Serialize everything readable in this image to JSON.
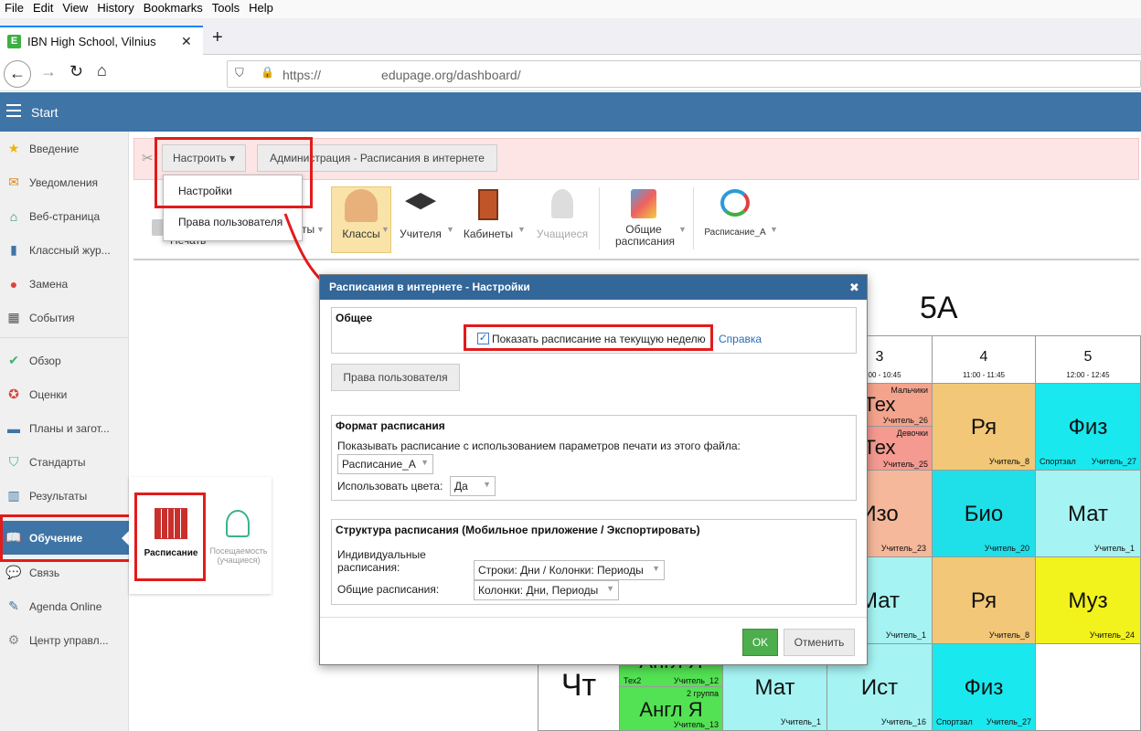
{
  "browser": {
    "menu": [
      "File",
      "Edit",
      "View",
      "History",
      "Bookmarks",
      "Tools",
      "Help"
    ],
    "tab_title": "IBN High School, Vilnius",
    "url_prefix": "https://",
    "url_domain": "edupage.org/dashboard/",
    "new_tab": "+",
    "close_tab": "✕"
  },
  "app": {
    "header_title": "Start"
  },
  "sidebar": {
    "items": [
      {
        "label": "Введение",
        "icon": "star-icon",
        "color": "#f0b400"
      },
      {
        "label": "Уведомления",
        "icon": "mail-icon",
        "color": "#e08a1e"
      },
      {
        "label": "Веб-страница",
        "icon": "home-icon",
        "color": "#2e8b57"
      },
      {
        "label": "Классный жур...",
        "icon": "book-icon",
        "color": "#3f74a6"
      },
      {
        "label": "Замена",
        "icon": "person-icon",
        "color": "#d9453b"
      },
      {
        "label": "События",
        "icon": "calendar-icon",
        "color": "#555"
      },
      {
        "label": "Обзор",
        "icon": "check-circle-icon",
        "color": "#3cb371"
      },
      {
        "label": "Оценки",
        "icon": "grade-icon",
        "color": "#d9453b"
      },
      {
        "label": "Планы и загот...",
        "icon": "briefcase-icon",
        "color": "#3f74a6"
      },
      {
        "label": "Стандарты",
        "icon": "shield-icon",
        "color": "#3cb371"
      },
      {
        "label": "Результаты",
        "icon": "bar-chart-icon",
        "color": "#3f74a6"
      },
      {
        "label": "Обучение",
        "icon": "open-book-icon",
        "color": "#ffffff"
      },
      {
        "label": "Связь",
        "icon": "chat-icon",
        "color": "#d9453b"
      },
      {
        "label": "Agenda Online",
        "icon": "pen-icon",
        "color": "#3f74a6"
      },
      {
        "label": "Центр управл...",
        "icon": "gear-icon",
        "color": "#888"
      }
    ]
  },
  "toolbar": {
    "settings_button": "Настроить ▾",
    "breadcrumb_button": "Администрация - Расписания в интернете",
    "dropdown": [
      "Настройки",
      "Права пользователя"
    ],
    "items": [
      {
        "label": "Классы"
      },
      {
        "label": "Учителя"
      },
      {
        "label": "Кабинеты"
      },
      {
        "label": "Учащиеся"
      },
      {
        "label": "Общие расписания"
      },
      {
        "label": "Расписание_А"
      }
    ],
    "partial_left": "ты",
    "partial_left2": "Печать"
  },
  "learning_panel": {
    "timetable_label": "Расписание",
    "attendance_label": "Посещаемость (учащиеся)"
  },
  "dialog": {
    "title": "Расписания в интернете - Настройки",
    "close": "✖",
    "general": {
      "title": "Общее",
      "checkbox_label": "Показать расписание на текущую неделю",
      "checkbox_checked": true,
      "help_link": "Справка",
      "rights_button": "Права пользователя"
    },
    "format": {
      "title": "Формат расписания",
      "print_label": "Показывать расписание с использованием параметров печати из этого файла:",
      "print_value": "Расписание_А",
      "colors_label": "Использовать цвета:",
      "colors_value": "Да"
    },
    "structure": {
      "title": "Структура расписания (Мобильное приложение / Экспортировать)",
      "individual_label": "Индивидуальные расписания:",
      "individual_value": "Строки: Дни / Колонки: Периоды",
      "common_label": "Общие расписания:",
      "common_value": "Колонки: Дни, Периоды"
    },
    "ok": "OK",
    "cancel": "Отменить"
  },
  "timetable": {
    "class_name": "5A",
    "periods": [
      {
        "num": "3",
        "time": "10:00 - 10:45"
      },
      {
        "num": "4",
        "time": "11:00 - 11:45"
      },
      {
        "num": "5",
        "time": "12:00 - 12:45"
      }
    ],
    "day_label": "Чт",
    "cells": {
      "r1c3_top": {
        "subject": "Тех",
        "note": "Мальчики",
        "teacher": "Учитель_26"
      },
      "r1c3_bot": {
        "subject": "Тех",
        "note": "Девочки",
        "teacher": "Учитель_25"
      },
      "r1c4": {
        "subject": "Ря",
        "teacher": "Учитель_8"
      },
      "r1c5": {
        "subject": "Физ",
        "room": "Спортзал",
        "teacher": "Учитель_27"
      },
      "r2c3": {
        "subject": "Изо",
        "teacher": "Учитель_23"
      },
      "r2c4": {
        "subject": "Био",
        "teacher": "Учитель_20"
      },
      "r2c5": {
        "subject": "Мат",
        "teacher": "Учитель_1"
      },
      "r3c3": {
        "subject": "Мат",
        "teacher": "Учитель_1"
      },
      "r3c4": {
        "subject": "Ря",
        "teacher": "Учитель_8"
      },
      "r3c5": {
        "subject": "Муз",
        "teacher": "Учитель_24"
      },
      "r4c1_top": {
        "subject": "Англ Я",
        "room": "Тех2",
        "teacher": "Учитель_12"
      },
      "r4c1_bot": {
        "subject": "Англ Я",
        "note": "2 группа",
        "teacher": "Учитель_13"
      },
      "r4c2": {
        "subject": "Мат",
        "teacher": "Учитель_1"
      },
      "r4c3": {
        "subject": "Ист",
        "teacher": "Учитель_16"
      },
      "r4c4": {
        "subject": "Физ",
        "room": "Спортзал",
        "teacher": "Учитель_27"
      }
    }
  },
  "colors": {
    "header": "#3f74a6",
    "technology": "#f4a48c",
    "russian": "#f2c777",
    "pe": "#19e8ee",
    "biology": "#1fe0e8",
    "math": "#a6f3f3",
    "music": "#f2f21c",
    "english": "#53e253",
    "annotation_red": "#e21b1b"
  }
}
